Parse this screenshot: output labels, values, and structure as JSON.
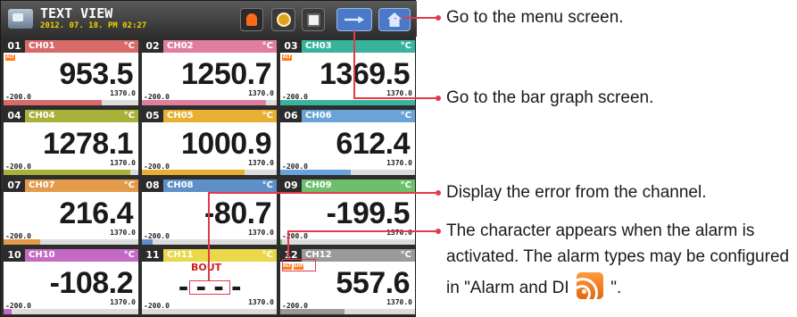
{
  "window": {
    "title": "TEXT VIEW",
    "datetime": "2012. 07. 18. PM 02:27"
  },
  "toolbar": {
    "icons": [
      "alarm-icon",
      "record-icon",
      "save-icon",
      "bar-graph-icon",
      "menu-home-icon"
    ]
  },
  "colors": {
    "accent": "#4a79c8",
    "callout": "#e23a4a",
    "value_text": "#1a1a1a"
  },
  "channels": [
    {
      "num": "01",
      "name": "CH01",
      "unit": "°C",
      "value": "953.5",
      "min": "-200.0",
      "max": "1370.0",
      "color": "#d96a6a",
      "alarms": [
        "ALT"
      ],
      "fill": 0.73
    },
    {
      "num": "02",
      "name": "CH02",
      "unit": "°C",
      "value": "1250.7",
      "min": "-200.0",
      "max": "1370.0",
      "color": "#e07ea0",
      "alarms": [],
      "fill": 0.92
    },
    {
      "num": "03",
      "name": "CH03",
      "unit": "°C",
      "value": "1369.5",
      "min": "-200.0",
      "max": "1370.0",
      "color": "#39b49c",
      "alarms": [
        "ALT"
      ],
      "fill": 1.0
    },
    {
      "num": "04",
      "name": "CH04",
      "unit": "°C",
      "value": "1278.1",
      "min": "-200.0",
      "max": "1370.0",
      "color": "#aab13b",
      "alarms": [],
      "fill": 0.94
    },
    {
      "num": "05",
      "name": "CH05",
      "unit": "°C",
      "value": "1000.9",
      "min": "-200.0",
      "max": "1370.0",
      "color": "#e8b032",
      "alarms": [],
      "fill": 0.76
    },
    {
      "num": "06",
      "name": "CH06",
      "unit": "°C",
      "value": "612.4",
      "min": "-200.0",
      "max": "1370.0",
      "color": "#6aa3d8",
      "alarms": [],
      "fill": 0.52
    },
    {
      "num": "07",
      "name": "CH07",
      "unit": "°C",
      "value": "216.4",
      "min": "-200.0",
      "max": "1370.0",
      "color": "#e39a4a",
      "alarms": [],
      "fill": 0.27
    },
    {
      "num": "08",
      "name": "CH08",
      "unit": "°C",
      "value": "-80.7",
      "min": "-200.0",
      "max": "1370.0",
      "color": "#5f8fc8",
      "alarms": [],
      "fill": 0.08
    },
    {
      "num": "09",
      "name": "CH09",
      "unit": "°C",
      "value": "-199.5",
      "min": "-200.0",
      "max": "1370.0",
      "color": "#6cc06c",
      "alarms": [],
      "fill": 0.01
    },
    {
      "num": "10",
      "name": "CH10",
      "unit": "°C",
      "value": "-108.2",
      "min": "-200.0",
      "max": "1370.0",
      "color": "#c46ac4",
      "alarms": [],
      "fill": 0.06
    },
    {
      "num": "11",
      "name": "CH11",
      "unit": "°C",
      "value": "- - - -",
      "min": "-200.0",
      "max": "1370.0",
      "color": "#e8d84a",
      "alarms": [],
      "error": "BOUT",
      "fill": 0.0
    },
    {
      "num": "12",
      "name": "CH12",
      "unit": "°C",
      "value": "557.6",
      "min": "-200.0",
      "max": "1370.0",
      "color": "#9a9a9a",
      "alarms": [
        "ALT",
        "SHF"
      ],
      "fill": 0.48
    }
  ],
  "annotations": {
    "menu_screen": "Go to the menu screen.",
    "bar_graph": "Go to the bar graph screen.",
    "error": "Display the error from the channel.",
    "alarm_line1": "The character appears when the alarm is",
    "alarm_line2": "activated. The alarm types may be configured",
    "alarm_line3_prefix": "in \"Alarm and DI",
    "alarm_line3_suffix": "\"."
  }
}
